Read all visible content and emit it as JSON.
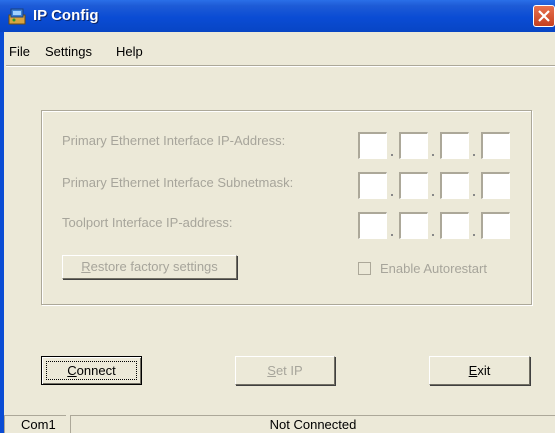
{
  "window": {
    "title": "IP Config"
  },
  "menu": {
    "file": "File",
    "settings": "Settings",
    "help": "Help"
  },
  "config": {
    "primary_ip_label": "Primary Ethernet Interface IP-Address:",
    "primary_mask_label": "Primary Ethernet Interface Subnetmask:",
    "toolport_ip_label": "Toolport Interface IP-address:",
    "primary_ip": [
      "",
      "",
      "",
      ""
    ],
    "primary_mask": [
      "",
      "",
      "",
      ""
    ],
    "toolport_ip": [
      "",
      "",
      "",
      ""
    ],
    "restore_label": "Restore factory settings",
    "restore_mnemonic": "R",
    "restore_rest": "estore factory settings",
    "autorestart_label": "Enable Autorestart",
    "autorestart_checked": false
  },
  "buttons": {
    "connect_mnemonic": "C",
    "connect_rest": "onnect",
    "setip_mnemonic": "S",
    "setip_rest": "et IP",
    "exit_mnemonic": "E",
    "exit_rest": "xit"
  },
  "status": {
    "port": "Com1",
    "connection": "Not Connected"
  },
  "colors": {
    "titlebar": "#0a4cd4",
    "disabled_text": "#a7a59b",
    "face": "#ece9d8"
  }
}
